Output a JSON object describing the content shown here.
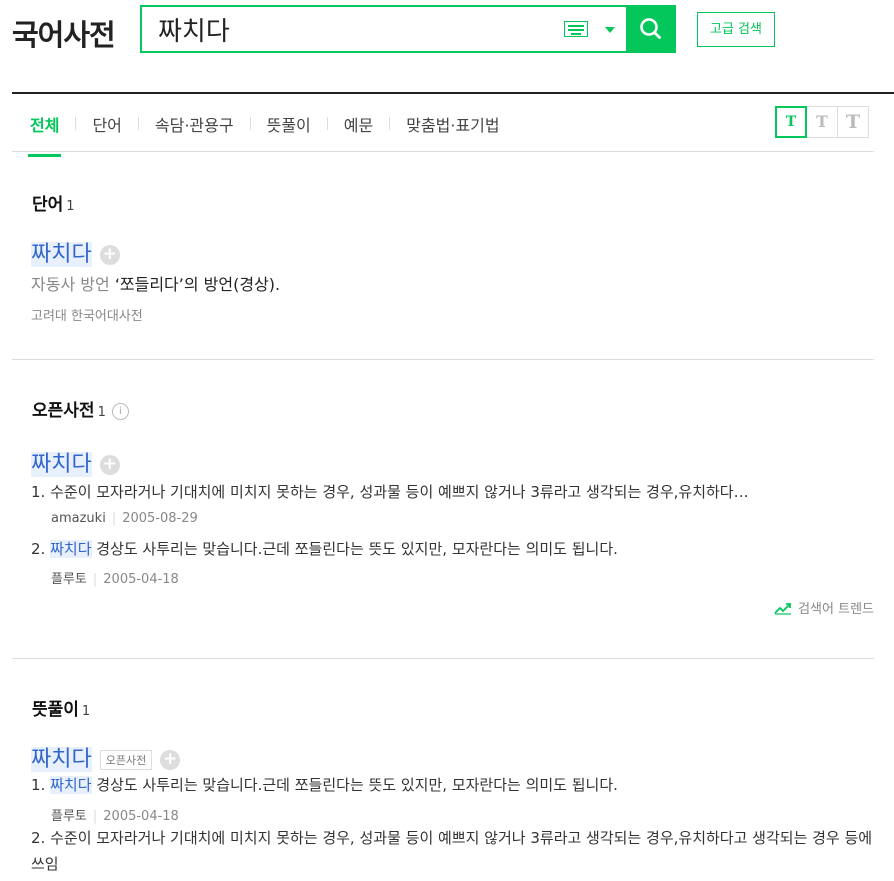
{
  "header": {
    "logo": "국어사전",
    "search": {
      "value": "짜치다"
    },
    "advanced_search": "고급 검색"
  },
  "tabs": [
    {
      "label": "전체",
      "active": true
    },
    {
      "label": "단어"
    },
    {
      "label": "속담·관용구"
    },
    {
      "label": "뜻풀이"
    },
    {
      "label": "예문"
    },
    {
      "label": "맞춤법·표기법"
    }
  ],
  "font_size_buttons": [
    "T",
    "T",
    "T"
  ],
  "sections": {
    "word": {
      "title": "단어",
      "count": "1",
      "entry": {
        "headword": "짜치다",
        "pos": "자동사",
        "region": "방언",
        "definition": "‘쪼들리다’의 방언(경상).",
        "source": "고려대 한국어대사전"
      }
    },
    "open_dict": {
      "title": "오픈사전",
      "count": "1",
      "info_icon": "i",
      "entry": {
        "headword": "짜치다",
        "defs": [
          {
            "num": "1.",
            "text": "수준이 모자라거나 기대치에 미치지 못하는 경우, 성과물 등이 예쁘지 않거나 3류라고 생각되는 경우,유치하다…",
            "user": "amazuki",
            "date": "2005-08-29"
          },
          {
            "num": "2.",
            "hl": "짜치다",
            "text": " 경상도 사투리는 맞습니다.근데 쪼들린다는 뜻도 있지만, 모자란다는 의미도 됩니다.",
            "user": "플루토",
            "date": "2005-04-18"
          }
        ]
      },
      "trend": "검색어 트렌드"
    },
    "meaning": {
      "title": "뜻풀이",
      "count": "1",
      "entry": {
        "headword": "짜치다",
        "tag": "오픈사전",
        "defs": [
          {
            "num": "1.",
            "hl": "짜치다",
            "text": " 경상도 사투리는 맞습니다.근데 쪼들린다는 뜻도 있지만, 모자란다는 의미도 됩니다.",
            "user": "플루토",
            "date": "2005-04-18"
          },
          {
            "num": "2.",
            "text": "수준이 모자라거나 기대치에 미치지 못하는 경우, 성과물 등이 예쁘지 않거나 3류라고 생각되는 경우,유치하다고 생각되는 경우 등에 쓰임"
          }
        ]
      }
    }
  },
  "colors": {
    "accent": "#03c75a",
    "link": "#3366cc",
    "highlight": "#e7f0fc"
  }
}
